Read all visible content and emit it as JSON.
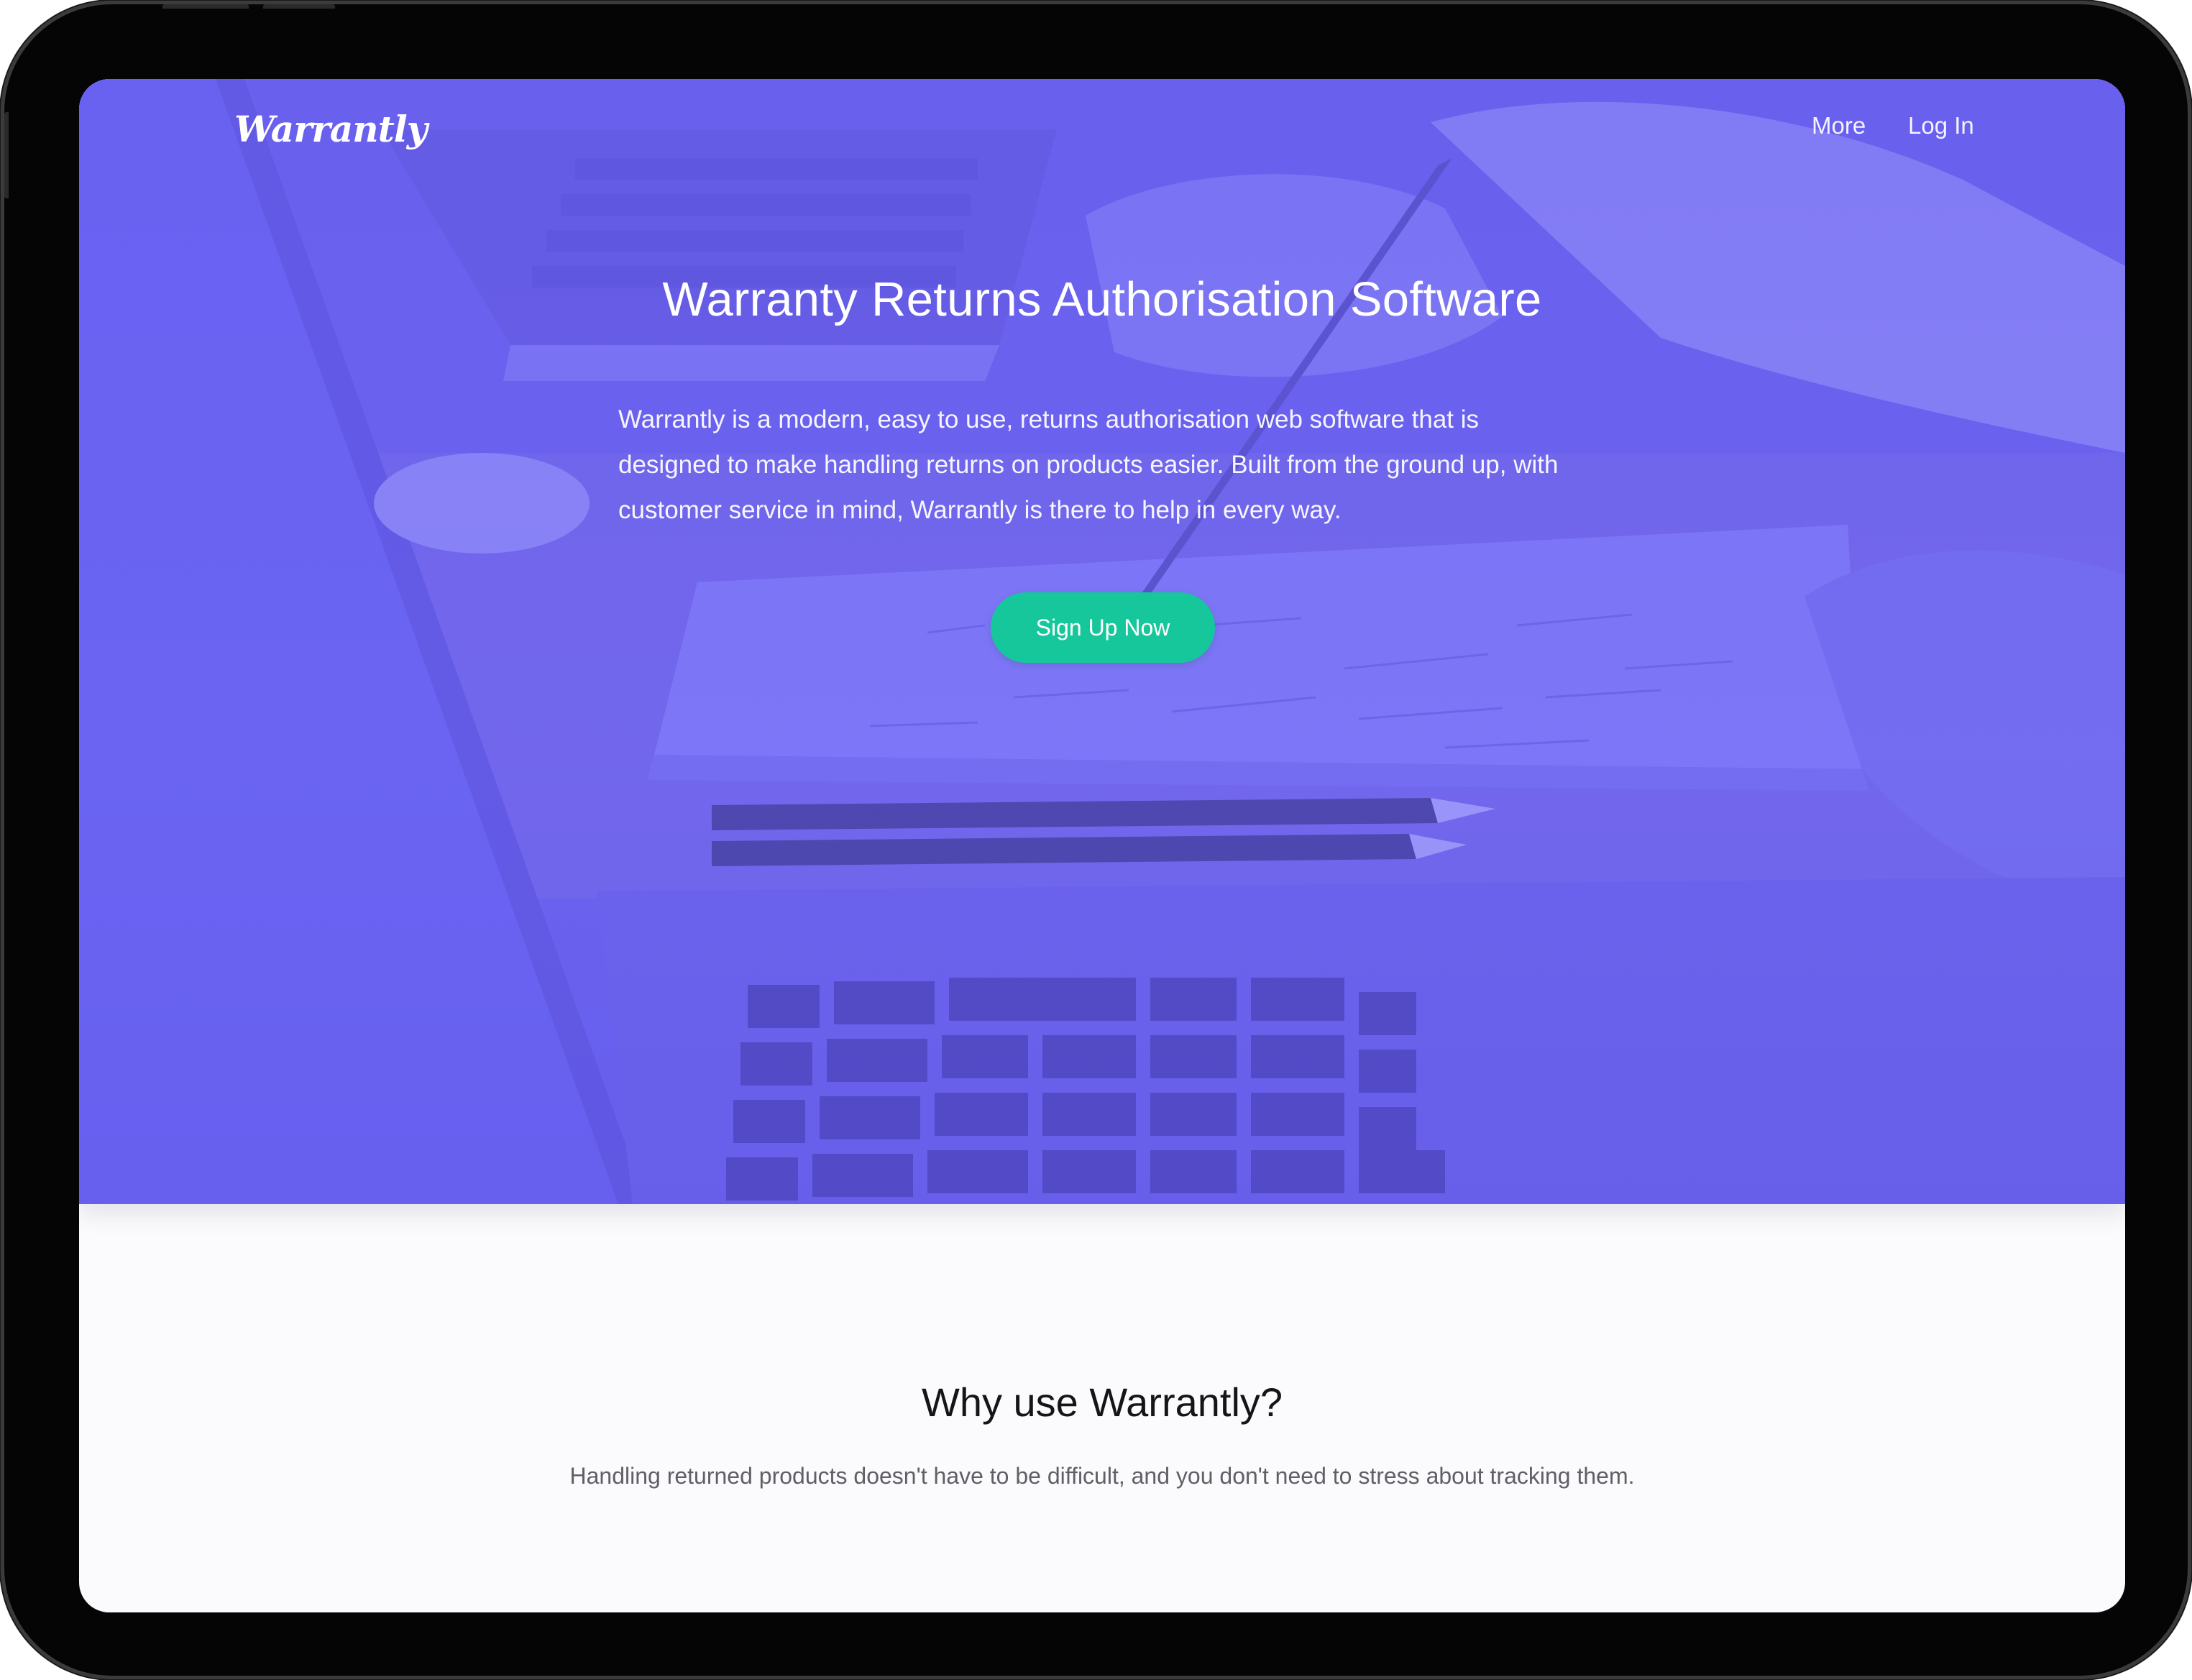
{
  "nav": {
    "logo": "Warrantly",
    "links": [
      "More",
      "Log In"
    ]
  },
  "hero": {
    "title": "Warranty Returns Authorisation Software",
    "description": "Warrantly is a modern, easy to use, returns authorisation web software that is designed to make handling returns on products easier. Built from the ground up, with customer service in mind, Warrantly is there to help in every way.",
    "cta_label": "Sign Up Now",
    "background_image": "laptop-and-notebook-photo"
  },
  "why": {
    "title": "Why use Warrantly?",
    "text": "Handling returned products doesn't have to be difficult, and you don't need to stress about tracking them."
  },
  "colors": {
    "hero_overlay": "#6b62ee",
    "cta": "#15c79a",
    "device_frame": "#050505",
    "page_background": "#fbfbfd"
  }
}
